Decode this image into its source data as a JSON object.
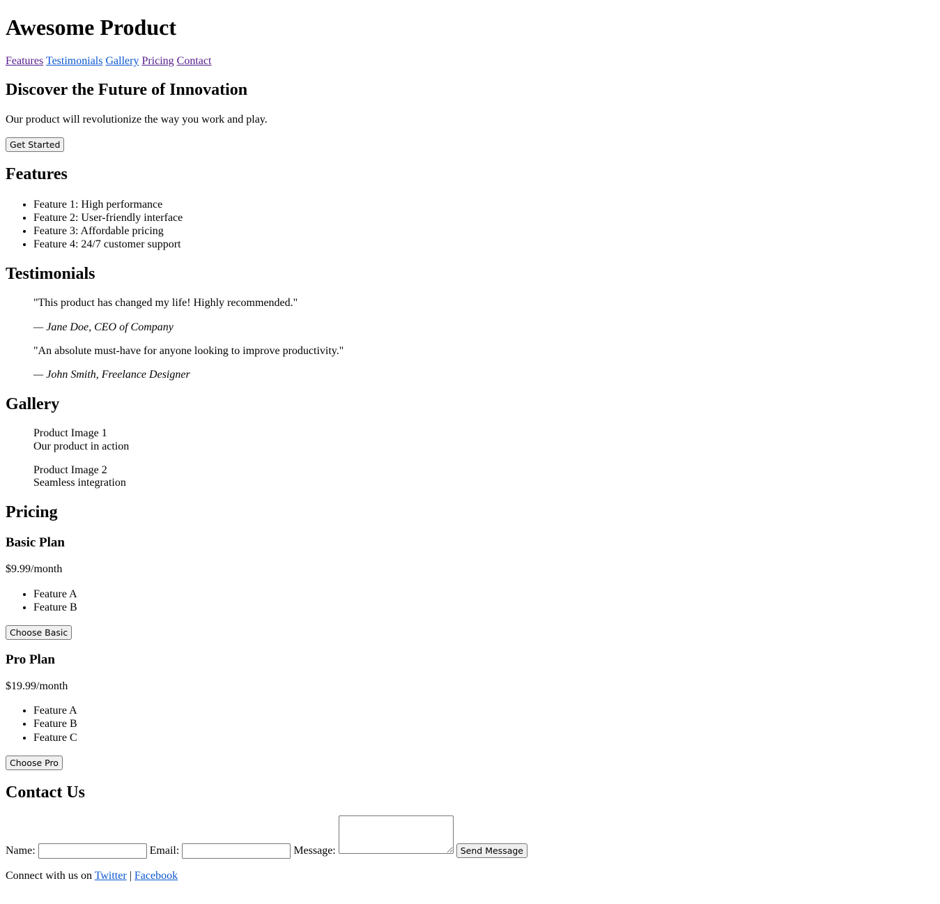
{
  "header": {
    "title": "Awesome Product",
    "nav": [
      {
        "label": "Features",
        "visited": true
      },
      {
        "label": "Testimonials",
        "visited": false
      },
      {
        "label": "Gallery",
        "visited": false
      },
      {
        "label": "Pricing",
        "visited": true
      },
      {
        "label": "Contact",
        "visited": true
      }
    ]
  },
  "hero": {
    "heading": "Discover the Future of Innovation",
    "text": "Our product will revolutionize the way you work and play.",
    "cta_label": "Get Started"
  },
  "features": {
    "heading": "Features",
    "items": [
      "Feature 1: High performance",
      "Feature 2: User-friendly interface",
      "Feature 3: Affordable pricing",
      "Feature 4: 24/7 customer support"
    ]
  },
  "testimonials": {
    "heading": "Testimonials",
    "items": [
      {
        "quote": "\"This product has changed my life! Highly recommended.\"",
        "author": "— Jane Doe, CEO of Company"
      },
      {
        "quote": "\"An absolute must-have for anyone looking to improve productivity.\"",
        "author": "— John Smith, Freelance Designer"
      }
    ]
  },
  "gallery": {
    "heading": "Gallery",
    "items": [
      {
        "image_alt": "Product Image 1",
        "caption": "Our product in action"
      },
      {
        "image_alt": "Product Image 2",
        "caption": "Seamless integration"
      }
    ]
  },
  "pricing": {
    "heading": "Pricing",
    "plans": [
      {
        "name": "Basic Plan",
        "price": "$9.99/month",
        "features": [
          "Feature A",
          "Feature B"
        ],
        "button": "Choose Basic"
      },
      {
        "name": "Pro Plan",
        "price": "$19.99/month",
        "features": [
          "Feature A",
          "Feature B",
          "Feature C"
        ],
        "button": "Choose Pro"
      }
    ]
  },
  "contact": {
    "heading": "Contact Us",
    "name_label": "Name:",
    "email_label": "Email:",
    "message_label": "Message:",
    "name_value": "",
    "email_value": "",
    "message_value": "",
    "submit_label": "Send Message"
  },
  "footer": {
    "prefix": "Connect with us on ",
    "separator": " | ",
    "links": [
      "Twitter",
      "Facebook"
    ]
  },
  "colors": {
    "link": "#0b57d0",
    "visited_link": "#551a8b"
  }
}
